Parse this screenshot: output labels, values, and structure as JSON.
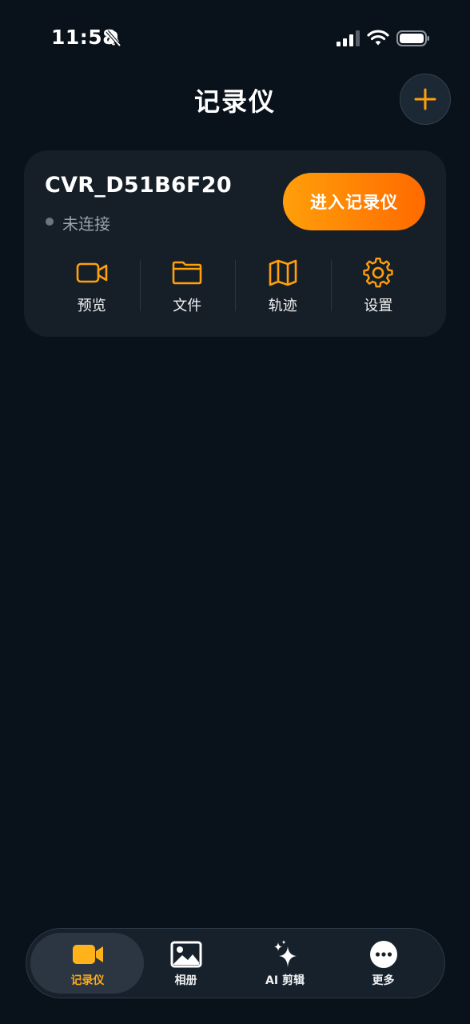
{
  "status_bar": {
    "time": "11:58"
  },
  "header": {
    "title": "记录仪",
    "add_label": "+"
  },
  "device": {
    "name": "CVR_D51B6F20",
    "status": "未连接",
    "enter_label": "进入记录仪",
    "actions": [
      {
        "label": "预览",
        "icon": "video-camera-icon"
      },
      {
        "label": "文件",
        "icon": "folder-icon"
      },
      {
        "label": "轨迹",
        "icon": "map-icon"
      },
      {
        "label": "设置",
        "icon": "gear-icon"
      }
    ]
  },
  "tabs": [
    {
      "label": "记录仪",
      "icon": "video-camera-icon",
      "active": true
    },
    {
      "label": "相册",
      "icon": "image-icon",
      "active": false
    },
    {
      "label": "AI 剪辑",
      "icon": "sparkle-icon",
      "active": false
    },
    {
      "label": "更多",
      "icon": "more-icon",
      "active": false
    }
  ],
  "colors": {
    "accent": "#ff9500",
    "background": "#09111a",
    "card": "#161f28"
  }
}
